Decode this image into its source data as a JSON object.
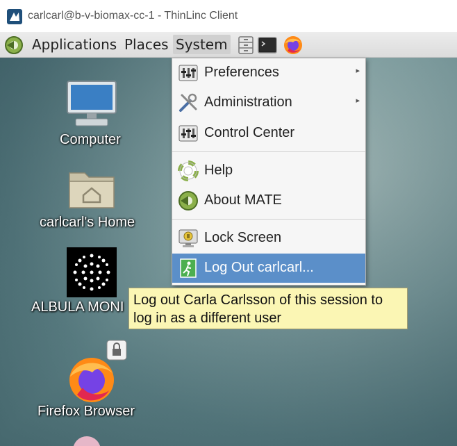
{
  "window": {
    "title": "carlcarl@b-v-biomax-cc-1 - ThinLinc Client"
  },
  "panel": {
    "menus": [
      "Applications",
      "Places",
      "System"
    ],
    "active_menu": "System",
    "launchers": [
      "file-cabinet-icon",
      "terminal-icon",
      "firefox-icon"
    ]
  },
  "desktop": {
    "icons": [
      {
        "label": "Computer",
        "icon": "computer-icon"
      },
      {
        "label": "carlcarl's Home",
        "icon": "home-folder-icon"
      },
      {
        "label": "ALBULA MONI",
        "icon": "albula-icon"
      },
      {
        "label": "Firefox Browser",
        "icon": "firefox-icon"
      }
    ]
  },
  "system_menu": {
    "items": [
      {
        "label": "Preferences",
        "icon": "preferences-icon",
        "submenu": true
      },
      {
        "label": "Administration",
        "icon": "tools-icon",
        "submenu": true
      },
      {
        "label": "Control Center",
        "icon": "control-center-icon",
        "submenu": false
      },
      {
        "label": "Help",
        "icon": "lifebuoy-icon",
        "submenu": false
      },
      {
        "label": "About MATE",
        "icon": "mate-logo-icon",
        "submenu": false
      },
      {
        "label": "Lock Screen",
        "icon": "lock-screen-icon",
        "submenu": false
      },
      {
        "label": "Log Out carlcarl...",
        "icon": "logout-icon",
        "submenu": false,
        "highlighted": true
      }
    ],
    "arrow_glyph": "▸"
  },
  "tooltip": {
    "line1": "Log out Carla Carlsson of this session to",
    "line2": "log in as a different user"
  },
  "colors": {
    "highlight": "#5b8fc9",
    "tooltip_bg": "#fbf6b4",
    "panel_bg": "#e4e4e4"
  }
}
